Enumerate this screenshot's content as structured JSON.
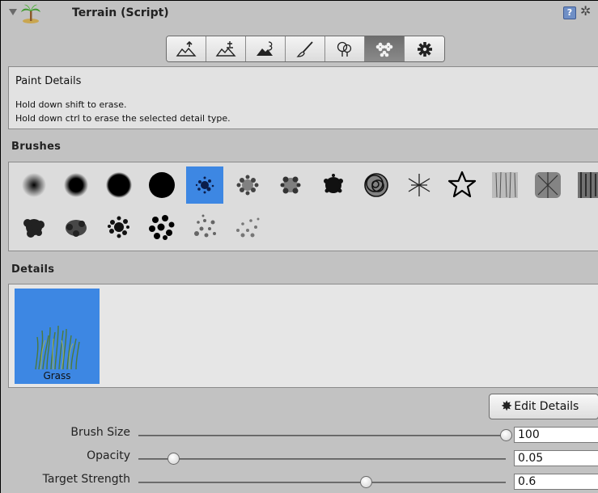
{
  "header": {
    "title": "Terrain (Script)",
    "component_icon": "palm-tree-icon",
    "help_icon": "help-book-icon",
    "settings_icon": "gear-icon"
  },
  "toolbar": {
    "tools": [
      {
        "name": "raise-lower-terrain",
        "icon": "raise-terrain-icon"
      },
      {
        "name": "paint-height",
        "icon": "paint-height-icon"
      },
      {
        "name": "smooth-height",
        "icon": "smooth-height-icon"
      },
      {
        "name": "paint-texture",
        "icon": "paint-brush-icon"
      },
      {
        "name": "place-trees",
        "icon": "tree-icon"
      },
      {
        "name": "paint-details",
        "icon": "flower-icon",
        "active": true
      },
      {
        "name": "terrain-settings",
        "icon": "gear-icon"
      }
    ]
  },
  "info": {
    "title": "Paint Details",
    "line1": "Hold down shift to erase.",
    "line2": "Hold down ctrl to erase the selected detail type."
  },
  "brushes": {
    "label": "Brushes",
    "selected_index": 4
  },
  "details": {
    "label": "Details",
    "items": [
      {
        "name": "Grass"
      }
    ]
  },
  "edit_details": {
    "label": "Edit Details",
    "icon": "gear-icon"
  },
  "sliders": [
    {
      "label": "Brush Size",
      "value": "100",
      "fraction": 1.0
    },
    {
      "label": "Opacity",
      "value": "0.05",
      "fraction": 0.05
    },
    {
      "label": "Target Strength",
      "value": "0.6",
      "fraction": 0.6
    }
  ],
  "colors": {
    "selection": "#3d87e3",
    "panel": "#c2c2c2"
  }
}
